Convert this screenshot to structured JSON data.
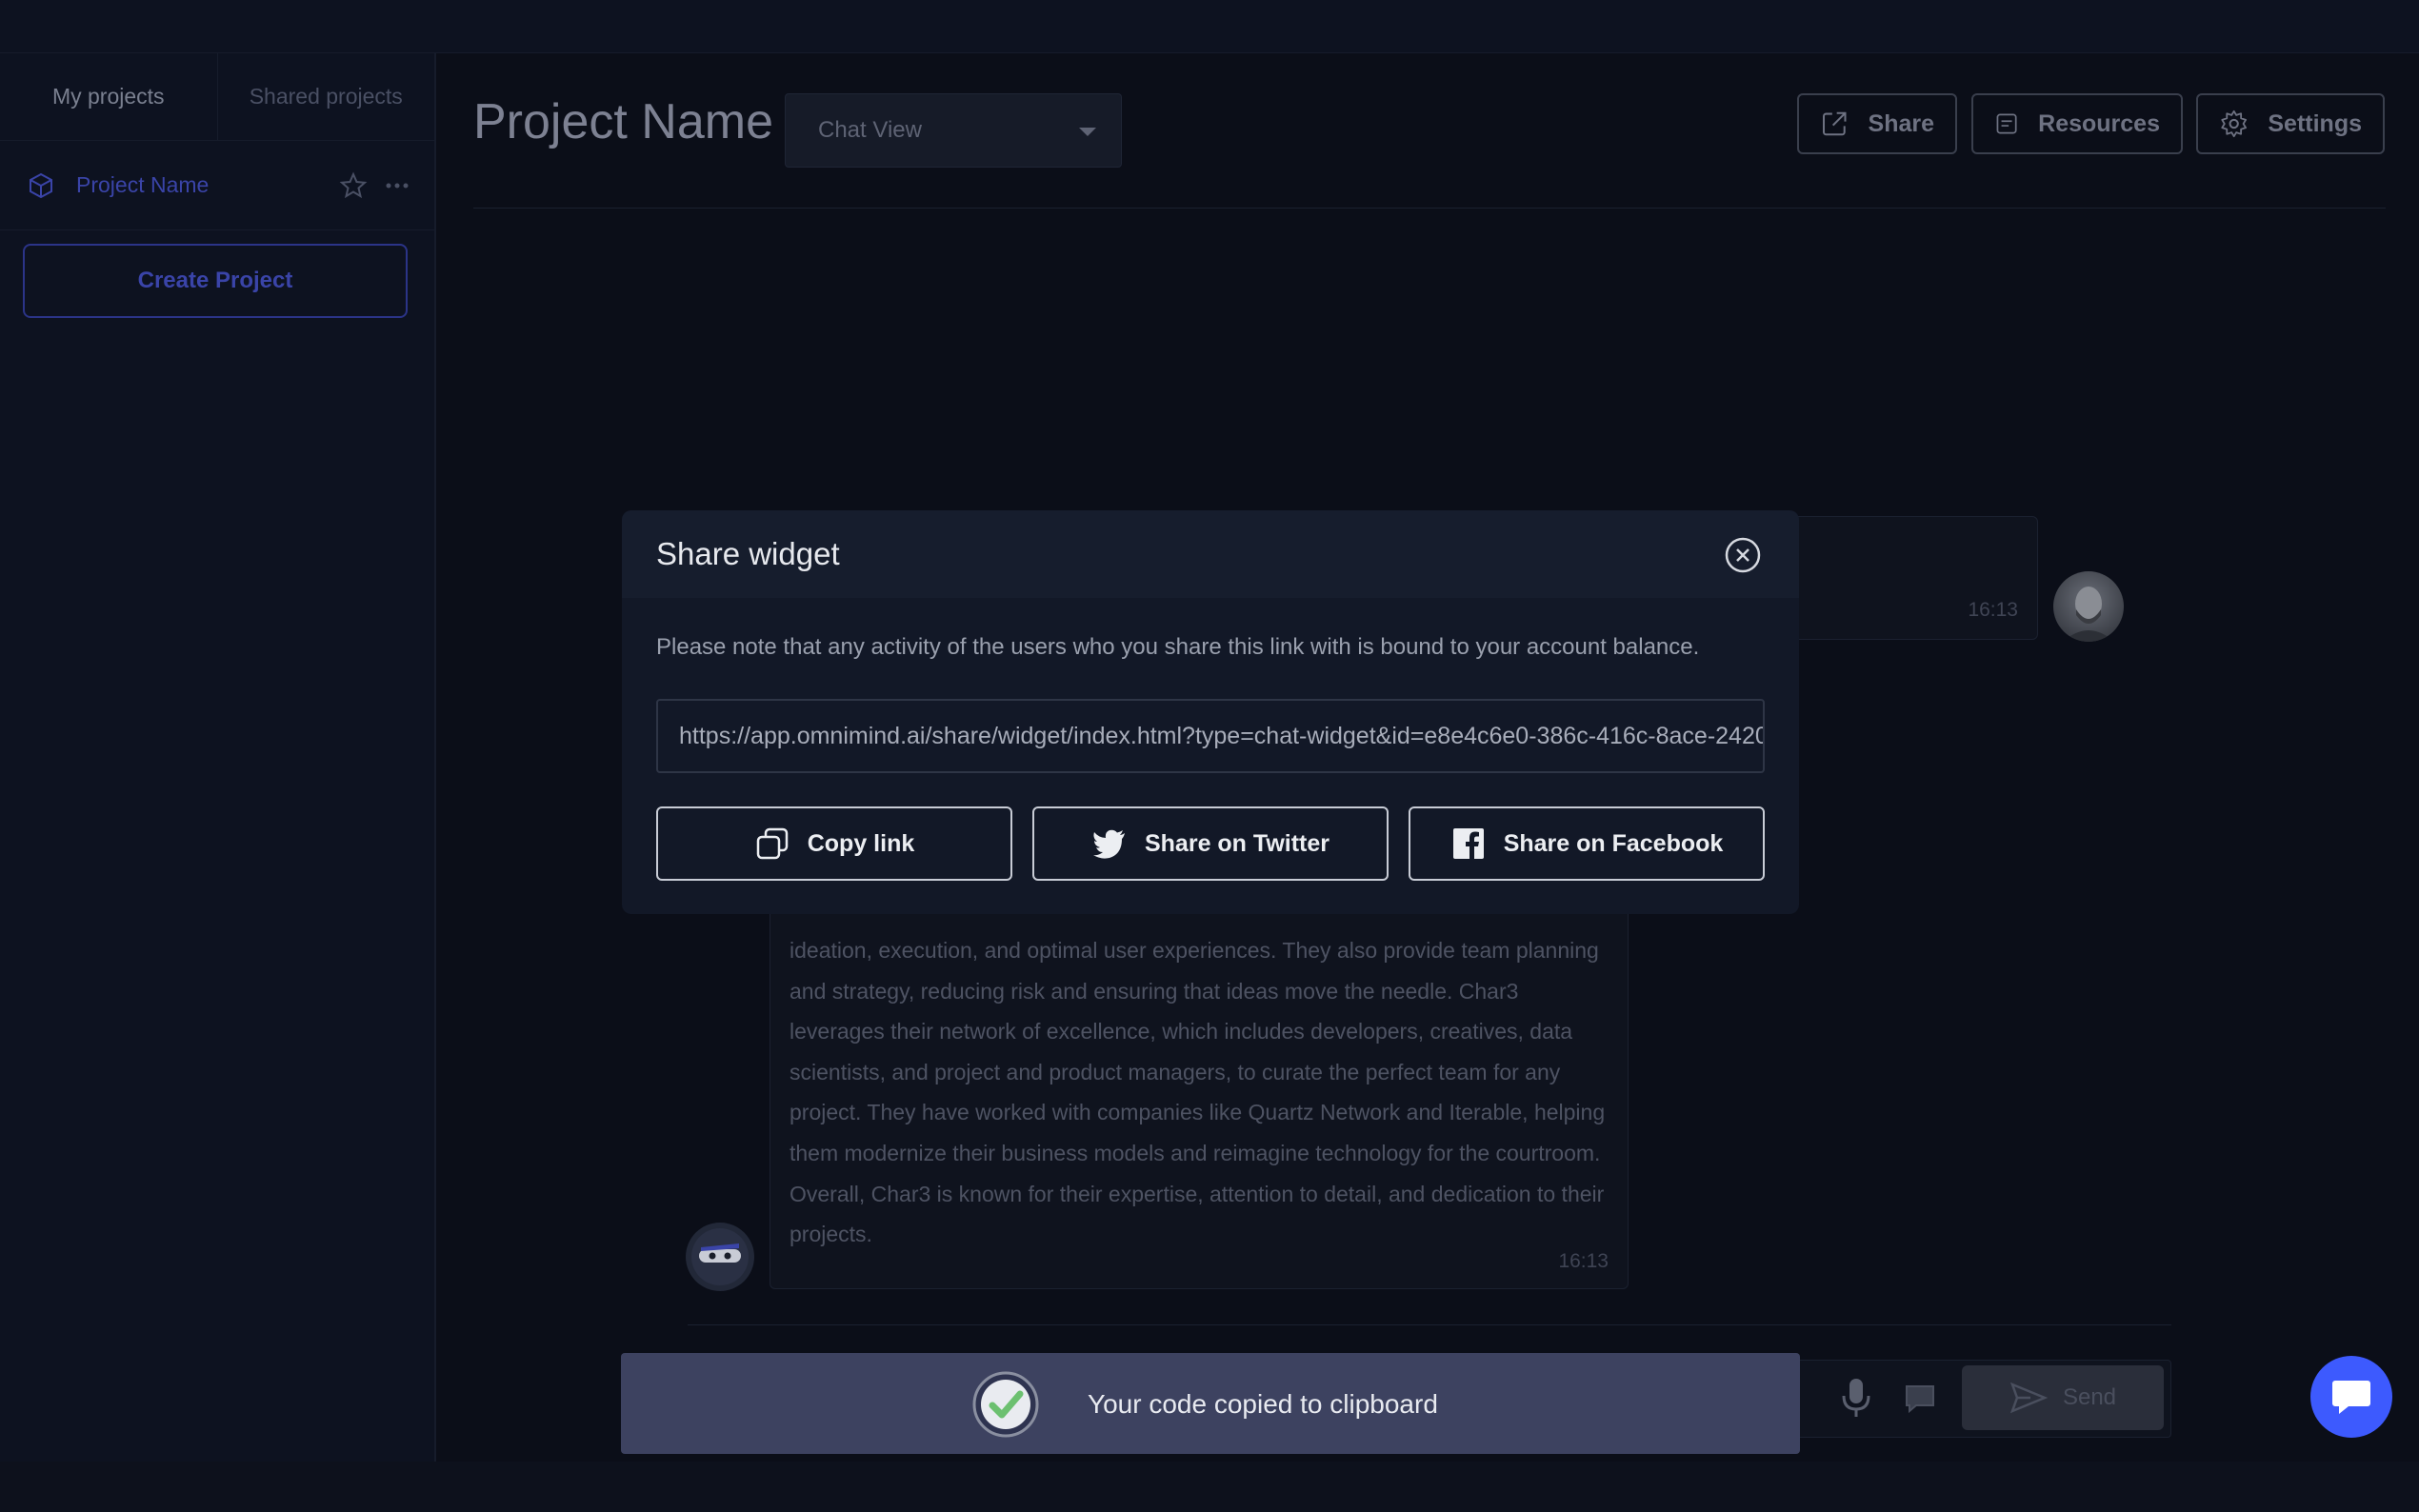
{
  "sidebar": {
    "tabs": [
      {
        "label": "My projects",
        "active": true
      },
      {
        "label": "Shared projects",
        "active": false
      }
    ],
    "project": {
      "name": "Project Name",
      "icon": "cube-icon"
    },
    "create_button": "Create Project"
  },
  "header": {
    "title": "Project Name",
    "view_select": {
      "value": "Chat View"
    },
    "buttons": {
      "share": "Share",
      "resources": "Resources",
      "settings": "Settings"
    }
  },
  "chat": {
    "user_message": {
      "time": "16:13"
    },
    "bot_message": {
      "text": "ideation, execution, and optimal user experiences. They also provide team planning and strategy, reducing risk and ensuring that ideas move the needle. Char3 leverages their network of excellence, which includes developers, creatives, data scientists, and project and product managers, to curate the perfect team for any project. They have worked with companies like Quartz Network and Iterable, helping them modernize their business models and reimagine technology for the courtroom. Overall, Char3 is known for their expertise, attention to detail, and dedication to their projects.",
      "time": "16:13"
    },
    "send_label": "Send"
  },
  "modal": {
    "title": "Share widget",
    "note": "Please note that any activity of the users who you share this link with is bound to your account balance.",
    "url": "https://app.omnimind.ai/share/widget/index.html?type=chat-widget&id=e8e4c6e0-386c-416c-8ace-2420",
    "buttons": {
      "copy": "Copy link",
      "twitter": "Share on Twitter",
      "facebook": "Share on Facebook"
    }
  },
  "toast": {
    "message": "Your code copied to clipboard"
  },
  "colors": {
    "accent": "#3a44a8",
    "fab": "#3d5afe",
    "toast_bg": "#3d4260",
    "check": "#6cc070"
  }
}
